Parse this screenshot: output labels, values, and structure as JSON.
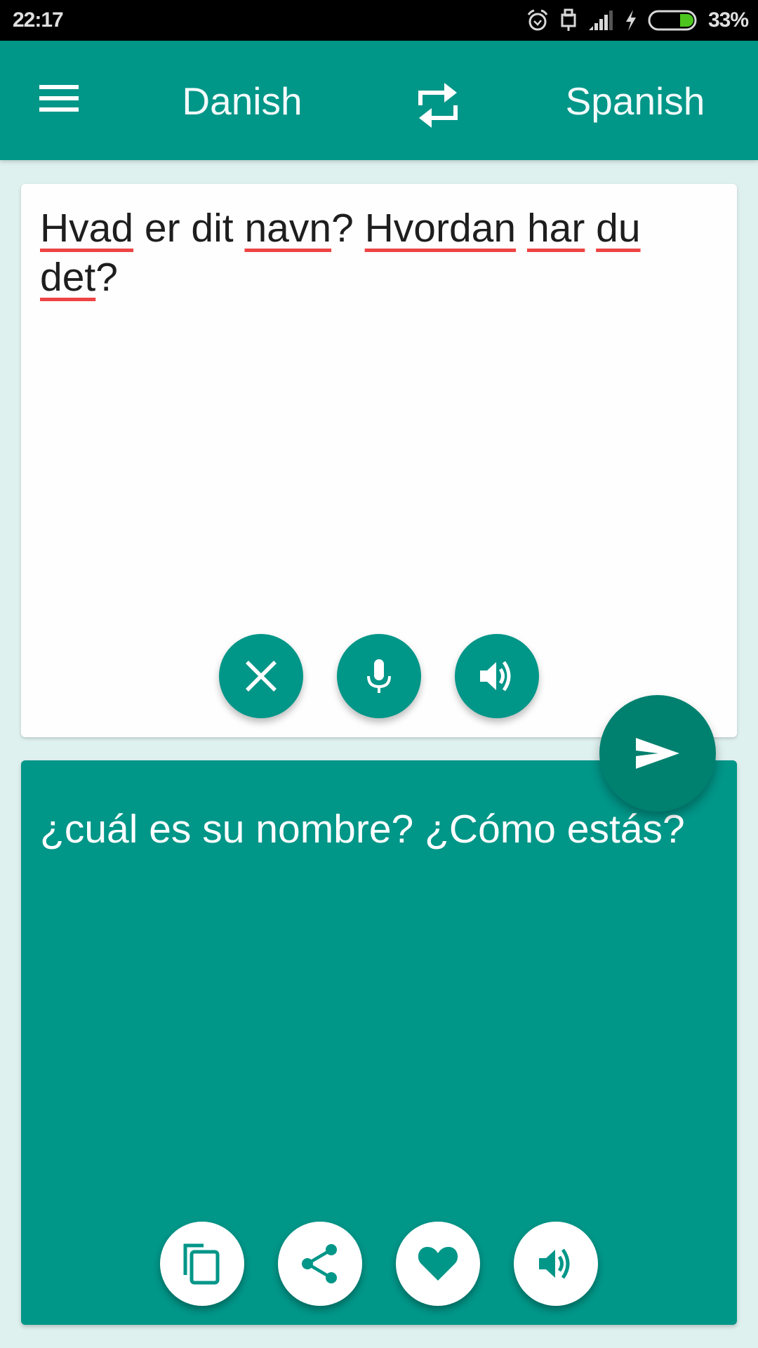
{
  "status_bar": {
    "time": "22:17",
    "icons": [
      "alarm-icon",
      "usb-debug-icon",
      "signal-icon",
      "charging-icon",
      "battery-icon"
    ],
    "battery_percent": "33%",
    "battery_level": 0.33,
    "battery_color": "#4cc61f"
  },
  "toolbar": {
    "menu_icon": "hamburger-menu-icon",
    "source_language": "Danish",
    "swap_icon": "swap-languages-icon",
    "target_language": "Spanish",
    "color": "#009688"
  },
  "source_panel": {
    "text_words": [
      {
        "w": "Hvad",
        "misspelled": true
      },
      {
        "w": " er dit ",
        "misspelled": false
      },
      {
        "w": "navn",
        "misspelled": true
      },
      {
        "w": "? ",
        "misspelled": false
      },
      {
        "w": "Hvordan",
        "misspelled": true
      },
      {
        "w": " ",
        "misspelled": false
      },
      {
        "w": "har",
        "misspelled": true
      },
      {
        "w": " ",
        "misspelled": false
      },
      {
        "w": "du",
        "misspelled": true
      },
      {
        "w": " ",
        "misspelled": false
      },
      {
        "w": "det",
        "misspelled": true
      },
      {
        "w": "?",
        "misspelled": false
      }
    ],
    "text": "Hvad er dit navn? Hvordan har du det?",
    "buttons": [
      {
        "name": "clear",
        "icon": "close-icon"
      },
      {
        "name": "voice-input",
        "icon": "microphone-icon"
      },
      {
        "name": "speak-source",
        "icon": "speaker-icon"
      }
    ]
  },
  "translate_button": {
    "icon": "send-icon",
    "color": "#00806f"
  },
  "target_panel": {
    "text": "¿cuál es su nombre? ¿Cómo estás?",
    "buttons": [
      {
        "name": "copy",
        "icon": "copy-icon"
      },
      {
        "name": "share",
        "icon": "share-icon"
      },
      {
        "name": "favorite",
        "icon": "heart-icon"
      },
      {
        "name": "speak-target",
        "icon": "speaker-icon"
      }
    ]
  },
  "colors": {
    "background": "#dff1ef",
    "accent": "#009688",
    "spellcheck_underline": "#ee4444"
  }
}
